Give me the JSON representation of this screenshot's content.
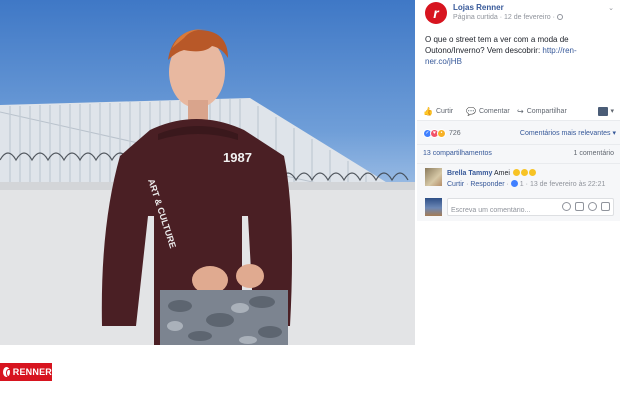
{
  "post": {
    "page_name": "Lojas Renner",
    "meta_label": "Página curtida",
    "meta_sep": " · ",
    "date": "12 de fevereiro",
    "meta_tail": " ·",
    "chevron": "⌄",
    "text_before_link": "O que o street tem a ver com a moda de Outono/Inverno? Vem descobrir: ",
    "link": "http://ren-ner.co/jHB"
  },
  "photo": {
    "shirt_print": "1987",
    "sleeve_print": "ART & CULTURE"
  },
  "brand_logo_text": "RENNER",
  "actions": {
    "like": "Curtir",
    "comment": "Comentar",
    "share": "Compartilhar",
    "viewer_caret": "▾"
  },
  "reactions": {
    "count": "726",
    "relevance_filter": "Comentários mais relevantes ▾"
  },
  "stats": {
    "shares": "13 compartilhamentos",
    "comments": "1 comentário"
  },
  "comment": {
    "author": "Brella Tammy",
    "text": " Amei",
    "like_link": "Curtir",
    "reply_link": "Responder",
    "likes": "1",
    "timestamp": "13 de fevereiro às 22:21"
  },
  "write_comment": {
    "placeholder": "Escreva um comentário..."
  },
  "colors": {
    "link": "#365899",
    "brand_red": "#d7141f",
    "muted": "#90949c"
  }
}
